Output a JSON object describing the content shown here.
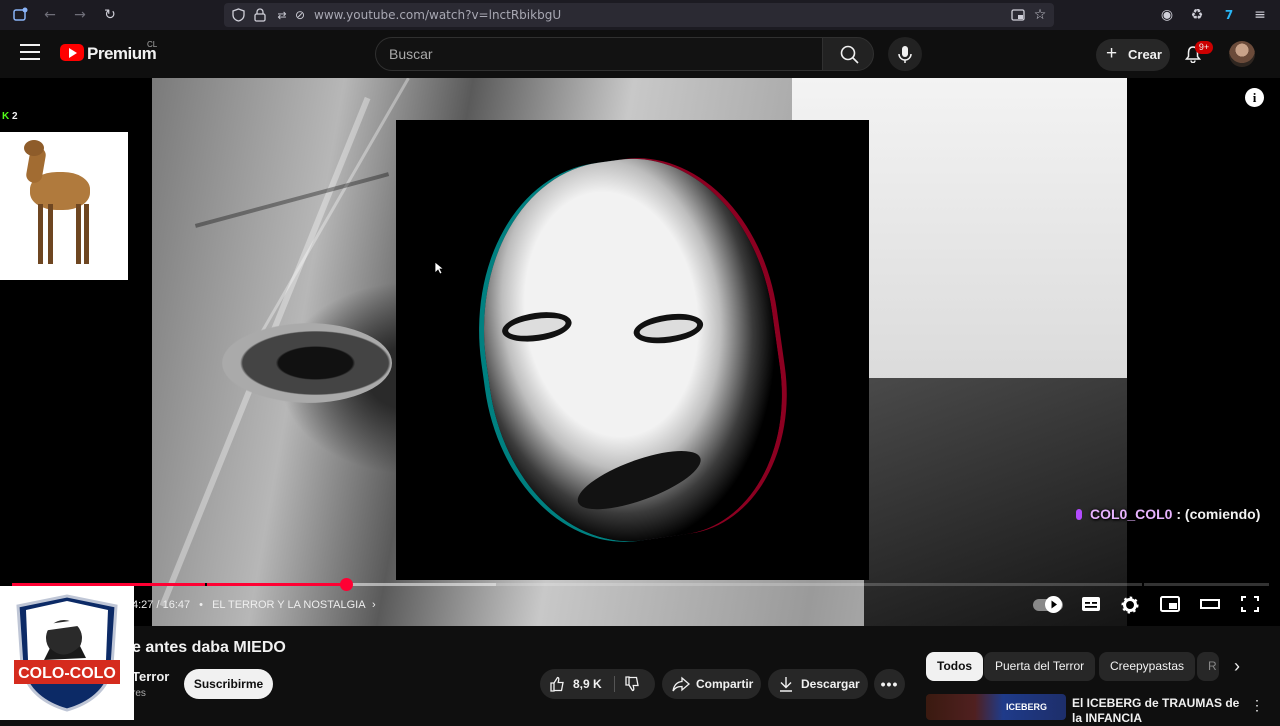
{
  "browser": {
    "url": "www.youtube.com/watch?v=lnctRbikbgU"
  },
  "header": {
    "brand": "Premium",
    "country": "CL",
    "search_placeholder": "Buscar",
    "create_label": "Crear",
    "notification_count": "9+"
  },
  "player": {
    "overlay_badge_count": "2",
    "chat_user": "COL0_COL0",
    "chat_message": " : (comiendo)",
    "time": "4:27 / 16:47",
    "chapter": "EL TERROR Y LA NOSTALGIA",
    "progress_fraction": 0.266,
    "buffer_fraction": 0.385,
    "info_icon": "i"
  },
  "video": {
    "title": "e antes daba MIEDO",
    "channel": "Terror",
    "subs": "res",
    "subscribe_label": "Suscribirme",
    "likes": "8,9 K",
    "share_label": "Compartir",
    "download_label": "Descargar"
  },
  "watermark": {
    "team": "COLO-COLO"
  },
  "sidebar": {
    "chips": [
      "Todos",
      "Puerta del Terror",
      "Creepypastas",
      "R"
    ],
    "rec_title": "El ICEBERG de TRAUMAS de la INFANCIA",
    "rec_thumb_text": "ICEBERG"
  }
}
